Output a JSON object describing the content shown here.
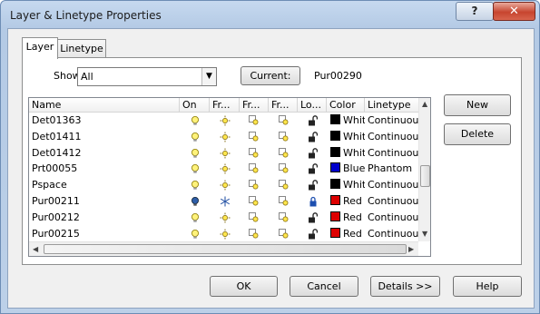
{
  "window": {
    "title": "Layer & Linetype Properties",
    "help_btn": "?",
    "close_btn": "✕"
  },
  "tabs": [
    {
      "label": "Layer"
    },
    {
      "label": "Linetype"
    }
  ],
  "show": {
    "label": "Show:",
    "value": "All"
  },
  "current": {
    "button": "Current:",
    "value": "Pur00290"
  },
  "columns": [
    "Name",
    "On",
    "Fr...",
    "Fr...",
    "Fr...",
    "Lo...",
    "Color",
    "Linetype"
  ],
  "rows": [
    {
      "name": "Det01363",
      "on": true,
      "frozen": false,
      "locked": false,
      "color": "White",
      "color_hex": "#000000",
      "linetype": "Continuous"
    },
    {
      "name": "Det01411",
      "on": true,
      "frozen": false,
      "locked": false,
      "color": "White",
      "color_hex": "#000000",
      "linetype": "Continuous"
    },
    {
      "name": "Det01412",
      "on": true,
      "frozen": false,
      "locked": false,
      "color": "White",
      "color_hex": "#000000",
      "linetype": "Continuous"
    },
    {
      "name": "Prt00055",
      "on": true,
      "frozen": false,
      "locked": false,
      "color": "Blue",
      "color_hex": "#0000cc",
      "linetype": "Phantom"
    },
    {
      "name": "Pspace",
      "on": true,
      "frozen": false,
      "locked": false,
      "color": "White",
      "color_hex": "#000000",
      "linetype": "Continuous"
    },
    {
      "name": "Pur00211",
      "on": false,
      "frozen": true,
      "locked": true,
      "color": "Red",
      "color_hex": "#dd0000",
      "linetype": "Continuous"
    },
    {
      "name": "Pur00212",
      "on": true,
      "frozen": false,
      "locked": false,
      "color": "Red",
      "color_hex": "#dd0000",
      "linetype": "Continuous"
    },
    {
      "name": "Pur00215",
      "on": true,
      "frozen": false,
      "locked": false,
      "color": "Red",
      "color_hex": "#dd0000",
      "linetype": "Continuous"
    }
  ],
  "side_buttons": {
    "new": "New",
    "delete": "Delete"
  },
  "footer_buttons": {
    "ok": "OK",
    "cancel": "Cancel",
    "details": "Details >>",
    "help": "Help"
  },
  "icons": {
    "on": "lightbulb-icon",
    "thaw": "sun-icon",
    "frozen": "snowflake-icon",
    "unlock": "padlock-open-icon",
    "lock": "padlock-closed-icon"
  }
}
